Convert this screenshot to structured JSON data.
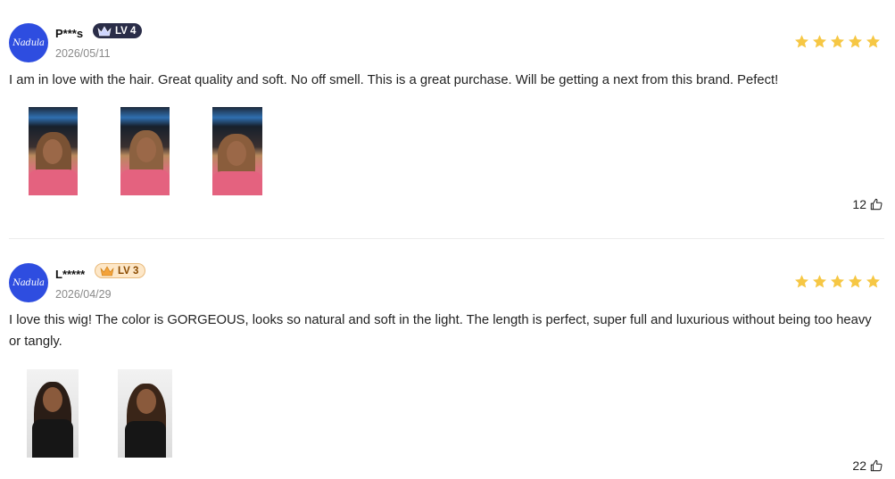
{
  "reviews": [
    {
      "avatar_text": "Nadula",
      "username": "P***s",
      "level": "LV 4",
      "date": "2026/05/11",
      "rating": 5,
      "text": "I am in love with the hair. Great quality and soft. No off smell. This is a great purchase. Will be getting a next from this brand. Pefect!",
      "photo_count": 3,
      "likes": "12"
    },
    {
      "avatar_text": "Nadula",
      "username": "L*****",
      "level": "LV 3",
      "date": "2026/04/29",
      "rating": 5,
      "text": "I love this wig! The color is GORGEOUS, looks so natural and soft in the light. The length is perfect, super full and luxurious without being too heavy or tangly.",
      "photo_count": 2,
      "likes": "22"
    }
  ],
  "colors": {
    "star": "#f6c744",
    "avatar": "#2e4de0",
    "badge_lv4": "#2a2d48",
    "badge_lv3": "#fde7c8"
  },
  "icons": {
    "like": "thumbs-up-icon",
    "star": "star-icon",
    "crown": "crown-icon"
  }
}
